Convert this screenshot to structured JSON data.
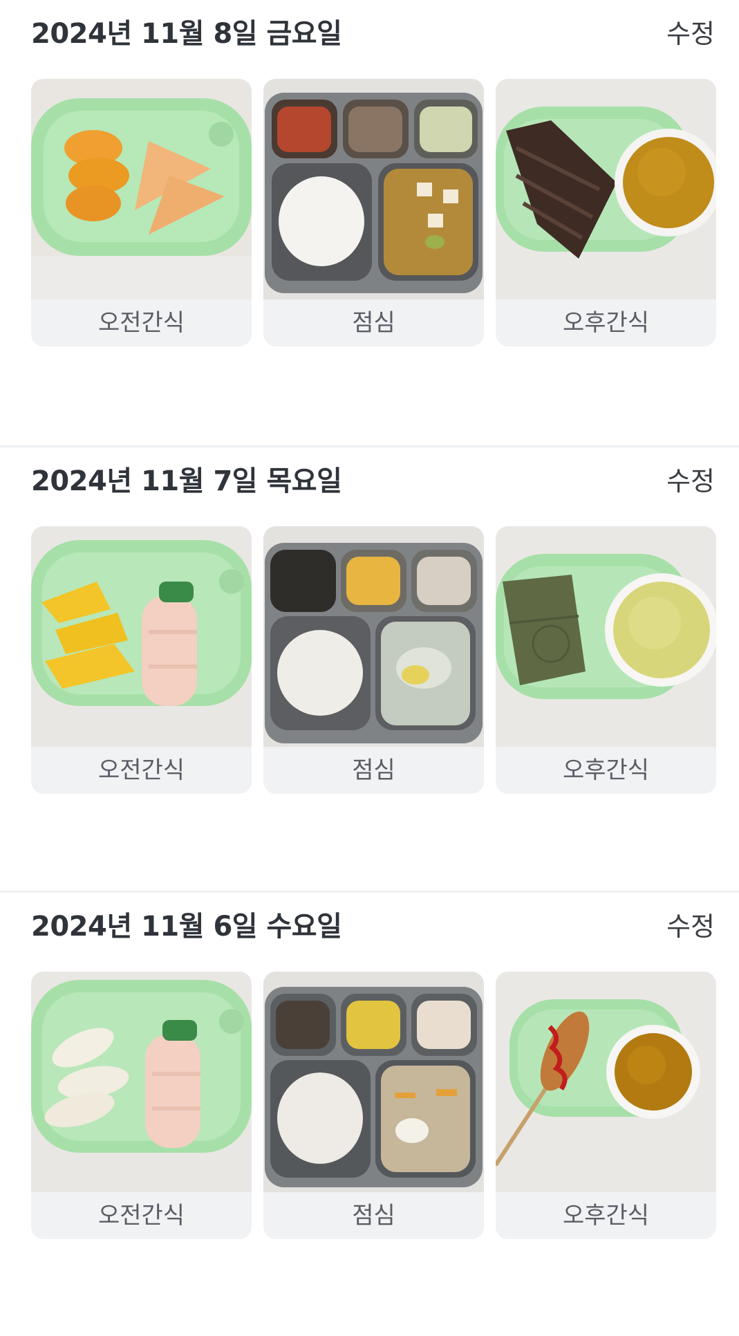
{
  "days": [
    {
      "date_title": "2024년 11월 8일 금요일",
      "edit_label": "수정",
      "meals": [
        {
          "label": "오전간식",
          "photo": "snack-persimmon-ham"
        },
        {
          "label": "점심",
          "photo": "lunch-tray-rice-soup"
        },
        {
          "label": "오후간식",
          "photo": "snack-chocolate-cake-tea"
        }
      ]
    },
    {
      "date_title": "2024년 11월 7일 목요일",
      "edit_label": "수정",
      "meals": [
        {
          "label": "오전간식",
          "photo": "snack-pineapple-yogurt-drink"
        },
        {
          "label": "점심",
          "photo": "lunch-tray-rice-dumpling-soup"
        },
        {
          "label": "오후간식",
          "photo": "snack-rice-cake-tea"
        }
      ]
    },
    {
      "date_title": "2024년 11월 6일 수요일",
      "edit_label": "수정",
      "meals": [
        {
          "label": "오전간식",
          "photo": "snack-pear-yogurt-drink"
        },
        {
          "label": "점심",
          "photo": "lunch-tray-rice-stew"
        },
        {
          "label": "오후간식",
          "photo": "snack-corndog-tea"
        }
      ]
    }
  ],
  "colors": {
    "plate_green": "#a6e0a8",
    "tray_steel": "#8a8d90",
    "card_bg": "#f1f2f4",
    "divider": "#eef0f2"
  }
}
